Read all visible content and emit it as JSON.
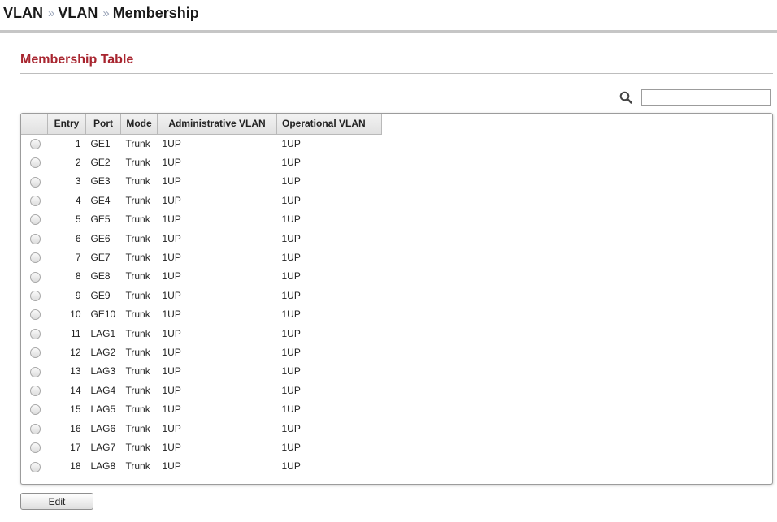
{
  "breadcrumb": {
    "items": [
      "VLAN",
      "VLAN",
      "Membership"
    ],
    "separator": "»"
  },
  "section": {
    "title": "Membership Table"
  },
  "search": {
    "icon": "search-icon",
    "value": "",
    "placeholder": ""
  },
  "table": {
    "columns": [
      "",
      "Entry",
      "Port",
      "Mode",
      "Administrative VLAN",
      "Operational VLAN"
    ],
    "rows": [
      {
        "entry": "1",
        "port": "GE1",
        "mode": "Trunk",
        "admin": "1UP",
        "oper": "1UP"
      },
      {
        "entry": "2",
        "port": "GE2",
        "mode": "Trunk",
        "admin": "1UP",
        "oper": "1UP"
      },
      {
        "entry": "3",
        "port": "GE3",
        "mode": "Trunk",
        "admin": "1UP",
        "oper": "1UP"
      },
      {
        "entry": "4",
        "port": "GE4",
        "mode": "Trunk",
        "admin": "1UP",
        "oper": "1UP"
      },
      {
        "entry": "5",
        "port": "GE5",
        "mode": "Trunk",
        "admin": "1UP",
        "oper": "1UP"
      },
      {
        "entry": "6",
        "port": "GE6",
        "mode": "Trunk",
        "admin": "1UP",
        "oper": "1UP"
      },
      {
        "entry": "7",
        "port": "GE7",
        "mode": "Trunk",
        "admin": "1UP",
        "oper": "1UP"
      },
      {
        "entry": "8",
        "port": "GE8",
        "mode": "Trunk",
        "admin": "1UP",
        "oper": "1UP"
      },
      {
        "entry": "9",
        "port": "GE9",
        "mode": "Trunk",
        "admin": "1UP",
        "oper": "1UP"
      },
      {
        "entry": "10",
        "port": "GE10",
        "mode": "Trunk",
        "admin": "1UP",
        "oper": "1UP"
      },
      {
        "entry": "11",
        "port": "LAG1",
        "mode": "Trunk",
        "admin": "1UP",
        "oper": "1UP"
      },
      {
        "entry": "12",
        "port": "LAG2",
        "mode": "Trunk",
        "admin": "1UP",
        "oper": "1UP"
      },
      {
        "entry": "13",
        "port": "LAG3",
        "mode": "Trunk",
        "admin": "1UP",
        "oper": "1UP"
      },
      {
        "entry": "14",
        "port": "LAG4",
        "mode": "Trunk",
        "admin": "1UP",
        "oper": "1UP"
      },
      {
        "entry": "15",
        "port": "LAG5",
        "mode": "Trunk",
        "admin": "1UP",
        "oper": "1UP"
      },
      {
        "entry": "16",
        "port": "LAG6",
        "mode": "Trunk",
        "admin": "1UP",
        "oper": "1UP"
      },
      {
        "entry": "17",
        "port": "LAG7",
        "mode": "Trunk",
        "admin": "1UP",
        "oper": "1UP"
      },
      {
        "entry": "18",
        "port": "LAG8",
        "mode": "Trunk",
        "admin": "1UP",
        "oper": "1UP"
      }
    ]
  },
  "actions": {
    "edit_label": "Edit"
  },
  "colors": {
    "title": "#a8252f",
    "separator": "#9aa4b8",
    "header_bg": "#e8e8e8"
  }
}
